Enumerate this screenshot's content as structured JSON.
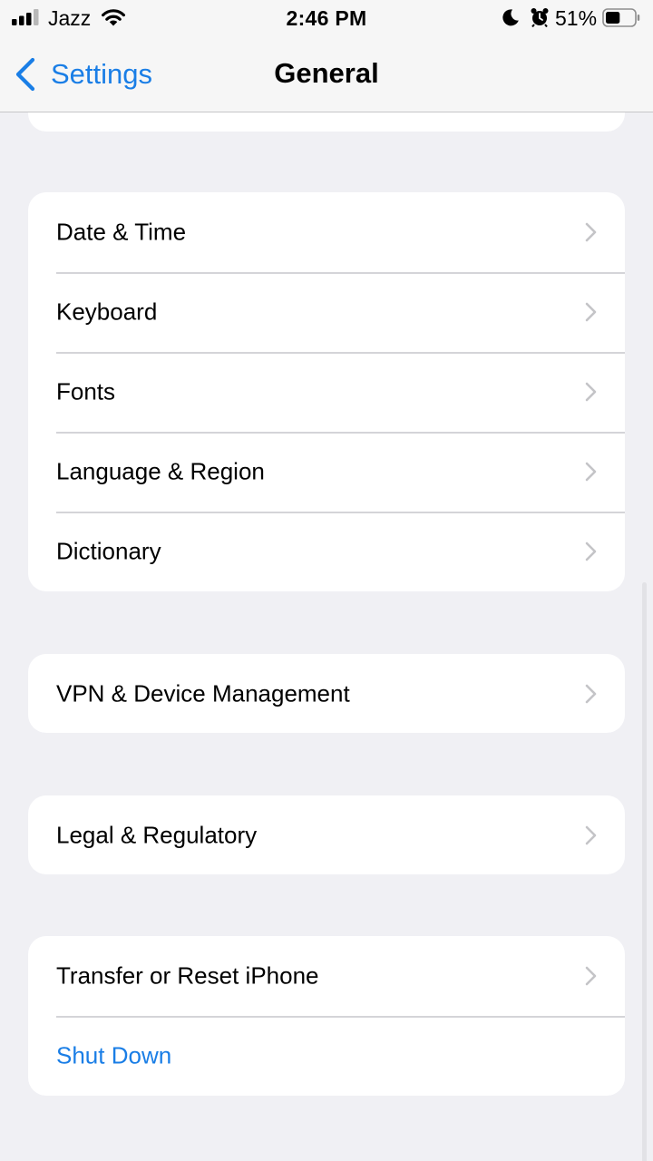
{
  "status_bar": {
    "carrier": "Jazz",
    "time": "2:46 PM",
    "battery_percent": "51%",
    "battery_level": 0.51,
    "signal_bars": 3,
    "signal_bars_total": 4,
    "icons": [
      "signal-icon",
      "wifi-icon",
      "moon-icon",
      "alarm-icon",
      "battery-icon"
    ]
  },
  "nav": {
    "back_label": "Settings",
    "title": "General"
  },
  "colors": {
    "accent": "#1a7ee6",
    "background": "#f0f0f4",
    "card": "#ffffff",
    "chevron": "#c4c4c7"
  },
  "groups": [
    {
      "rows": [
        {
          "label": "Date & Time"
        },
        {
          "label": "Keyboard"
        },
        {
          "label": "Fonts"
        },
        {
          "label": "Language & Region"
        },
        {
          "label": "Dictionary"
        }
      ]
    },
    {
      "rows": [
        {
          "label": "VPN & Device Management"
        }
      ]
    },
    {
      "rows": [
        {
          "label": "Legal & Regulatory"
        }
      ]
    },
    {
      "rows": [
        {
          "label": "Transfer or Reset iPhone"
        },
        {
          "label": "Shut Down"
        }
      ]
    }
  ]
}
